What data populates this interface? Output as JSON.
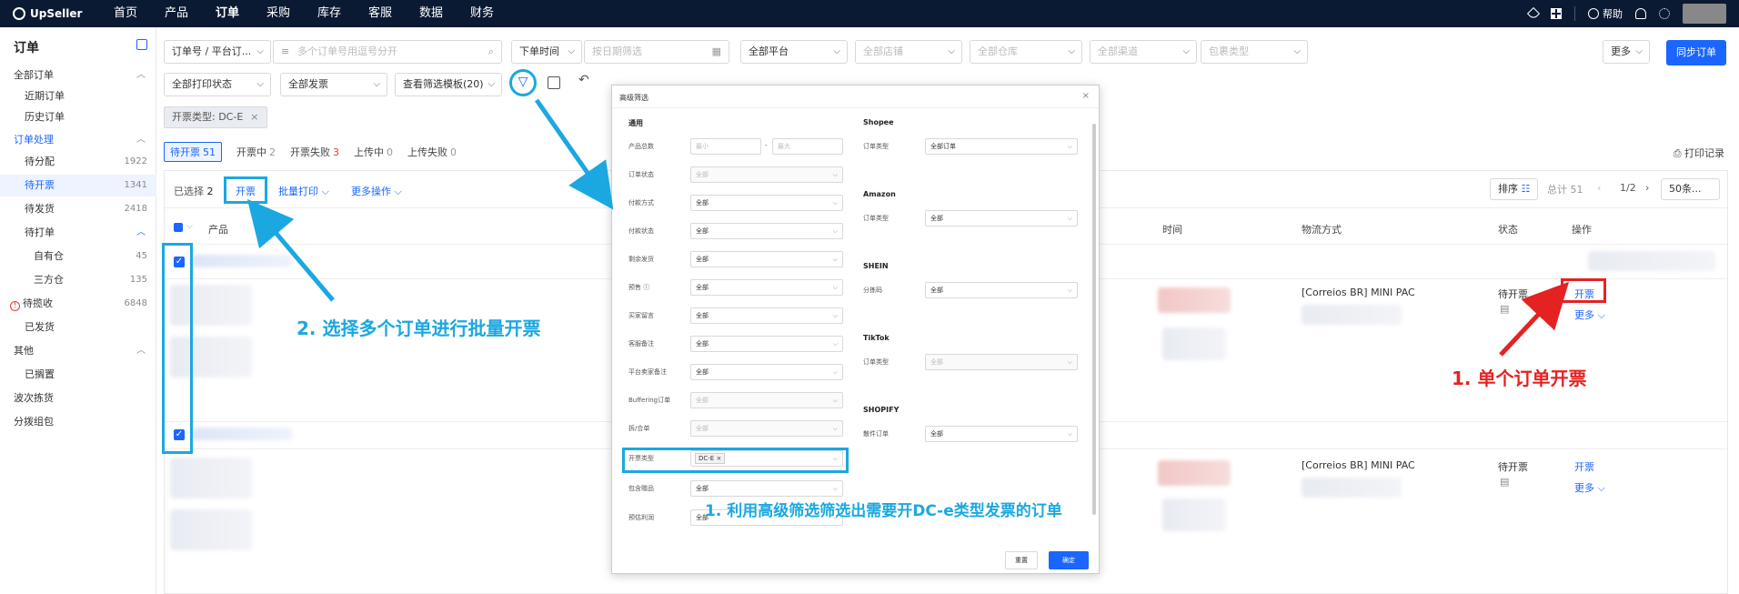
{
  "topbar": {
    "brand": "UpSeller",
    "nav": [
      "首页",
      "产品",
      "订单",
      "采购",
      "库存",
      "客服",
      "数据",
      "财务"
    ],
    "active_nav": "订单",
    "help": "帮助"
  },
  "sidebar": {
    "title": "订单",
    "items": [
      {
        "label": "全部订单",
        "count": "",
        "level": 0,
        "chevron": "^"
      },
      {
        "label": "近期订单",
        "count": "",
        "level": 1
      },
      {
        "label": "历史订单",
        "count": "",
        "level": 1
      },
      {
        "label": "订单处理",
        "count": "",
        "level": 0,
        "chevron": "^",
        "section": true
      },
      {
        "label": "待分配",
        "count": "1922",
        "level": 1
      },
      {
        "label": "待开票",
        "count": "1341",
        "level": 1,
        "active": true
      },
      {
        "label": "待发货",
        "count": "2418",
        "level": 1
      },
      {
        "label": "待打单",
        "count": "",
        "level": 1,
        "chevron": "^"
      },
      {
        "label": "自有仓",
        "count": "45",
        "level": 2
      },
      {
        "label": "三方仓",
        "count": "135",
        "level": 2
      },
      {
        "label": "待揽收",
        "count": "6848",
        "level": 1,
        "warn": true
      },
      {
        "label": "已发货",
        "count": "",
        "level": 1
      },
      {
        "label": "其他",
        "count": "",
        "level": 0,
        "chevron": "^"
      },
      {
        "label": "已搁置",
        "count": "",
        "level": 1
      },
      {
        "label": "波次拣货",
        "count": "",
        "level": 0
      },
      {
        "label": "分拨组包",
        "count": "",
        "level": 0
      }
    ]
  },
  "filters": {
    "order_no_type": "订单号 / 平台订...",
    "search_placeholder": "多个订单号用逗号分开",
    "time_type": "下单时间",
    "date_placeholder": "按日期筛选",
    "platform": "全部平台",
    "store": "全部店铺",
    "warehouse": "全部仓库",
    "channel": "全部渠道",
    "package_type": "包裹类型",
    "more": "更多",
    "sync": "同步订单",
    "print_status": "全部打印状态",
    "invoice": "全部发票",
    "template": "查看筛选模板(20)",
    "active_tag": "开票类型: DC-E"
  },
  "tabs": [
    {
      "label": "待开票",
      "count": "51",
      "active": true
    },
    {
      "label": "开票中",
      "count": "2"
    },
    {
      "label": "开票失败",
      "count": "3",
      "red": true
    },
    {
      "label": "上传中",
      "count": "0"
    },
    {
      "label": "上传失败",
      "count": "0"
    }
  ],
  "print_record": "打印记录",
  "bulk": {
    "selected_label": "已选择",
    "selected_count": "2",
    "invoice": "开票",
    "batch_print": "批量打印",
    "more_ops": "更多操作"
  },
  "pager": {
    "sort": "排序",
    "total": "总计 51",
    "page": "1/2",
    "page_size": "50条..."
  },
  "table": {
    "columns": [
      "产品",
      "时间",
      "物流方式",
      "状态",
      "操作"
    ],
    "rows": [
      {
        "logistics": "[Correios BR] MINI PAC",
        "status": "待开票",
        "action": "开票",
        "more": "更多"
      },
      {
        "logistics": "[Correios BR] MINI PAC",
        "status": "待开票",
        "action": "开票",
        "more": "更多"
      }
    ]
  },
  "modal": {
    "title": "高级筛选",
    "left_section": "通用",
    "left_fields": [
      {
        "label": "产品总数",
        "value": "",
        "range": true,
        "min": "最小",
        "max": "最大"
      },
      {
        "label": "订单状态",
        "value": "全部",
        "disabled": true
      },
      {
        "label": "付款方式",
        "value": "全部"
      },
      {
        "label": "付款状态",
        "value": "全部"
      },
      {
        "label": "剩余发货",
        "value": "全部"
      },
      {
        "label": "预售",
        "value": "全部",
        "info": true
      },
      {
        "label": "买家留言",
        "value": "全部"
      },
      {
        "label": "客服备注",
        "value": "全部"
      },
      {
        "label": "平台卖家备注",
        "value": "全部"
      },
      {
        "label": "Buffering订单",
        "value": "全部",
        "disabled": true
      },
      {
        "label": "拆/合单",
        "value": "全部",
        "disabled": true
      },
      {
        "label": "开票类型",
        "value": "",
        "tag": "DC-E"
      },
      {
        "label": "包含赠品",
        "value": "全部"
      },
      {
        "label": "预估利润",
        "value": "全部"
      }
    ],
    "right_sections": [
      {
        "name": "Shopee",
        "field": "订单类型",
        "value": "全部订单"
      },
      {
        "name": "Amazon",
        "field": "订单类型",
        "value": "全部"
      },
      {
        "name": "SHEIN",
        "field": "分拣码",
        "value": "全部"
      },
      {
        "name": "TikTok",
        "field": "订单类型",
        "value": "全部",
        "disabled": true
      },
      {
        "name": "SHOPIFY",
        "field": "散件订单",
        "value": "全部"
      }
    ],
    "reset": "重置",
    "confirm": "确定"
  },
  "annotations": {
    "step_filter": "1. 利用高级筛选筛选出需要开DC-e类型发票的订单",
    "step_single": "1. 单个订单开票",
    "step_batch": "2. 选择多个订单进行批量开票"
  },
  "colors": {
    "topbar": "#0b1a33",
    "primary": "#1a66ff",
    "annotation_blue": "#1ba8e0",
    "annotation_red": "#e52222"
  }
}
